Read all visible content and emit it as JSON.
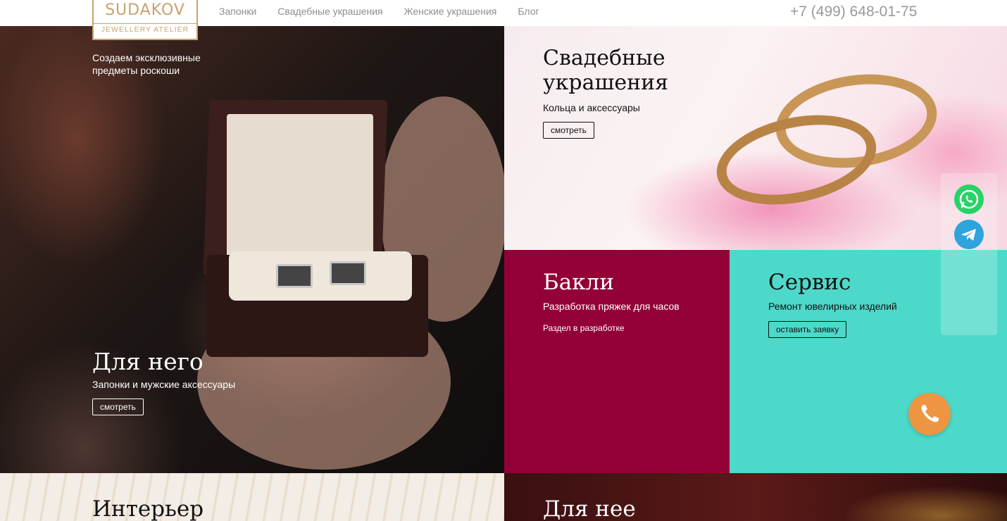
{
  "header": {
    "logo_main": "SUDAKOV",
    "logo_sub": "JEWELLERY ATELIER",
    "nav": [
      "Запонки",
      "Свадебные украшения",
      "Женские украшения",
      "Блог"
    ],
    "phone": "+7 (499) 648-01-75"
  },
  "hero": {
    "tagline_line1": "Создаем эксклюзивные",
    "tagline_line2": "предметы роскоши"
  },
  "tiles": {
    "him": {
      "title": "Для него",
      "subtitle": "Запонки и мужские аксессуары",
      "button": "смотреть"
    },
    "wedding": {
      "title_line1": "Свадебные",
      "title_line2": "украшения",
      "subtitle": "Кольца и аксессуары",
      "button": "смотреть"
    },
    "buckles": {
      "title": "Бакли",
      "subtitle": "Разработка пряжек для часов",
      "note": "Раздел в разработке"
    },
    "service": {
      "title": "Сервис",
      "subtitle": "Ремонт ювелирных изделий",
      "button": "оставить заявку"
    },
    "interior": {
      "title": "Интерьер"
    },
    "her": {
      "title": "Для нее"
    }
  },
  "colors": {
    "brand_gold": "#c9a26d",
    "buckle_bg": "#930037",
    "service_bg": "#4dd9c9",
    "call_button": "#ee9541",
    "whatsapp": "#25d366",
    "telegram": "#2ea3dc"
  },
  "widgets": {
    "icons": [
      "whatsapp-icon",
      "telegram-icon",
      "phone-icon"
    ]
  }
}
